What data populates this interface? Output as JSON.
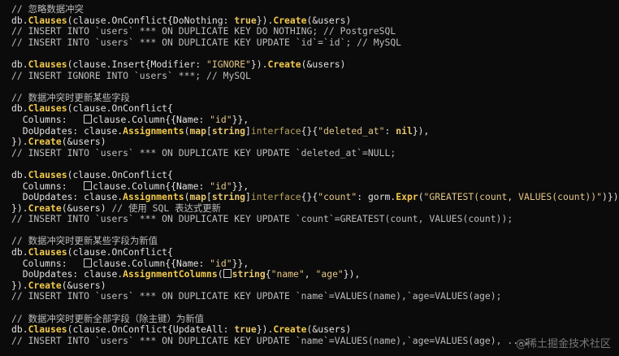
{
  "code_lines": [
    [
      {
        "t": "c",
        "v": "// 忽略数据冲突"
      }
    ],
    [
      {
        "t": "p",
        "v": "db."
      },
      {
        "t": "f",
        "v": "Clauses"
      },
      {
        "t": "p",
        "v": "(clause.OnConflict{DoNothing: "
      },
      {
        "t": "k",
        "v": "true"
      },
      {
        "t": "p",
        "v": "})."
      },
      {
        "t": "f",
        "v": "Create"
      },
      {
        "t": "p",
        "v": "(&users)"
      }
    ],
    [
      {
        "t": "c",
        "v": "// INSERT INTO `users` *** ON DUPLICATE KEY DO NOTHING; // PostgreSQL"
      }
    ],
    [
      {
        "t": "c",
        "v": "// INSERT INTO `users` *** ON DUPLICATE KEY UPDATE `id`=`id`; // MySQL"
      }
    ],
    [],
    [
      {
        "t": "p",
        "v": "db."
      },
      {
        "t": "f",
        "v": "Clauses"
      },
      {
        "t": "p",
        "v": "(clause.Insert{Modifier: "
      },
      {
        "t": "s",
        "v": "\"IGNORE\""
      },
      {
        "t": "p",
        "v": "})."
      },
      {
        "t": "f",
        "v": "Create"
      },
      {
        "t": "p",
        "v": "(&users)"
      }
    ],
    [
      {
        "t": "c",
        "v": "// INSERT IGNORE INTO `users` ***; // MySQL"
      }
    ],
    [],
    [
      {
        "t": "c",
        "v": "// 数据冲突时更新某些字段"
      }
    ],
    [
      {
        "t": "p",
        "v": "db."
      },
      {
        "t": "f",
        "v": "Clauses"
      },
      {
        "t": "p",
        "v": "(clause.OnConflict{"
      }
    ],
    [
      {
        "t": "p",
        "v": "  Columns:   "
      },
      {
        "t": "b",
        "v": ""
      },
      {
        "t": "p",
        "v": "clause.Column{{Name: "
      },
      {
        "t": "s",
        "v": "\"id\""
      },
      {
        "t": "p",
        "v": "}},"
      }
    ],
    [
      {
        "t": "p",
        "v": "  DoUpdates: clause."
      },
      {
        "t": "f",
        "v": "Assignments"
      },
      {
        "t": "p",
        "v": "("
      },
      {
        "t": "k",
        "v": "map"
      },
      {
        "t": "p",
        "v": "["
      },
      {
        "t": "k",
        "v": "string"
      },
      {
        "t": "p",
        "v": "]"
      },
      {
        "t": "k2",
        "v": "interface"
      },
      {
        "t": "p",
        "v": "{}{"
      },
      {
        "t": "s",
        "v": "\"deleted_at\""
      },
      {
        "t": "p",
        "v": ": "
      },
      {
        "t": "k",
        "v": "nil"
      },
      {
        "t": "p",
        "v": "}),"
      }
    ],
    [
      {
        "t": "p",
        "v": "})."
      },
      {
        "t": "f",
        "v": "Create"
      },
      {
        "t": "p",
        "v": "(&users)"
      }
    ],
    [
      {
        "t": "c",
        "v": "// INSERT INTO `users` *** ON DUPLICATE KEY UPDATE `deleted_at`=NULL;"
      }
    ],
    [],
    [
      {
        "t": "p",
        "v": "db."
      },
      {
        "t": "f",
        "v": "Clauses"
      },
      {
        "t": "p",
        "v": "(clause.OnConflict{"
      }
    ],
    [
      {
        "t": "p",
        "v": "  Columns:   "
      },
      {
        "t": "b",
        "v": ""
      },
      {
        "t": "p",
        "v": "clause.Column{{Name: "
      },
      {
        "t": "s",
        "v": "\"id\""
      },
      {
        "t": "p",
        "v": "}},"
      }
    ],
    [
      {
        "t": "p",
        "v": "  DoUpdates: clause."
      },
      {
        "t": "f",
        "v": "Assignments"
      },
      {
        "t": "p",
        "v": "("
      },
      {
        "t": "k",
        "v": "map"
      },
      {
        "t": "p",
        "v": "["
      },
      {
        "t": "k",
        "v": "string"
      },
      {
        "t": "p",
        "v": "]"
      },
      {
        "t": "k2",
        "v": "interface"
      },
      {
        "t": "p",
        "v": "{}{"
      },
      {
        "t": "s",
        "v": "\"count\""
      },
      {
        "t": "p",
        "v": ": gorm."
      },
      {
        "t": "f",
        "v": "Expr"
      },
      {
        "t": "p",
        "v": "("
      },
      {
        "t": "s",
        "v": "\"GREATEST(count, VALUES(count))\""
      },
      {
        "t": "p",
        "v": ")}),"
      }
    ],
    [
      {
        "t": "p",
        "v": "})."
      },
      {
        "t": "f",
        "v": "Create"
      },
      {
        "t": "p",
        "v": "(&users) "
      },
      {
        "t": "c",
        "v": "// 使用 SQL 表达式更新"
      }
    ],
    [
      {
        "t": "c",
        "v": "// INSERT INTO `users` *** ON DUPLICATE KEY UPDATE `count`=GREATEST(count, VALUES(count));"
      }
    ],
    [],
    [
      {
        "t": "c",
        "v": "// 数据冲突时更新某些字段为新值"
      }
    ],
    [
      {
        "t": "p",
        "v": "db."
      },
      {
        "t": "f",
        "v": "Clauses"
      },
      {
        "t": "p",
        "v": "(clause.OnConflict{"
      }
    ],
    [
      {
        "t": "p",
        "v": "  Columns:   "
      },
      {
        "t": "b",
        "v": ""
      },
      {
        "t": "p",
        "v": "clause.Column{{Name: "
      },
      {
        "t": "s",
        "v": "\"id\""
      },
      {
        "t": "p",
        "v": "}},"
      }
    ],
    [
      {
        "t": "p",
        "v": "  DoUpdates: clause."
      },
      {
        "t": "f",
        "v": "AssignmentColumns"
      },
      {
        "t": "p",
        "v": "("
      },
      {
        "t": "b",
        "v": ""
      },
      {
        "t": "k",
        "v": "string"
      },
      {
        "t": "p",
        "v": "{"
      },
      {
        "t": "s",
        "v": "\"name\""
      },
      {
        "t": "p",
        "v": ", "
      },
      {
        "t": "s",
        "v": "\"age\""
      },
      {
        "t": "p",
        "v": "}),"
      }
    ],
    [
      {
        "t": "p",
        "v": "})."
      },
      {
        "t": "f",
        "v": "Create"
      },
      {
        "t": "p",
        "v": "(&users)"
      }
    ],
    [
      {
        "t": "c",
        "v": "// INSERT INTO `users` *** ON DUPLICATE KEY UPDATE `name`=VALUES(name),`age=VALUES(age);"
      }
    ],
    [],
    [
      {
        "t": "c",
        "v": "// 数据冲突时更新全部字段（除主键）为新值"
      }
    ],
    [
      {
        "t": "p",
        "v": "db."
      },
      {
        "t": "f",
        "v": "Clauses"
      },
      {
        "t": "p",
        "v": "(clause.OnConflict{UpdateAll: "
      },
      {
        "t": "k",
        "v": "true"
      },
      {
        "t": "p",
        "v": "})."
      },
      {
        "t": "f",
        "v": "Create"
      },
      {
        "t": "p",
        "v": "(&users)"
      }
    ],
    [
      {
        "t": "c",
        "v": "// INSERT INTO `users` *** ON DUPLICATE KEY UPDATE `name`=VALUES(name),`age=VALUES(age), ...;"
      }
    ]
  ],
  "watermark": "@稀土掘金技术社区",
  "colors": {
    "background": "#0b0b0b",
    "comment": "#bdbdbd",
    "function": "#f2c94c",
    "string": "#e4c687",
    "keyword": "#e7c66a"
  }
}
